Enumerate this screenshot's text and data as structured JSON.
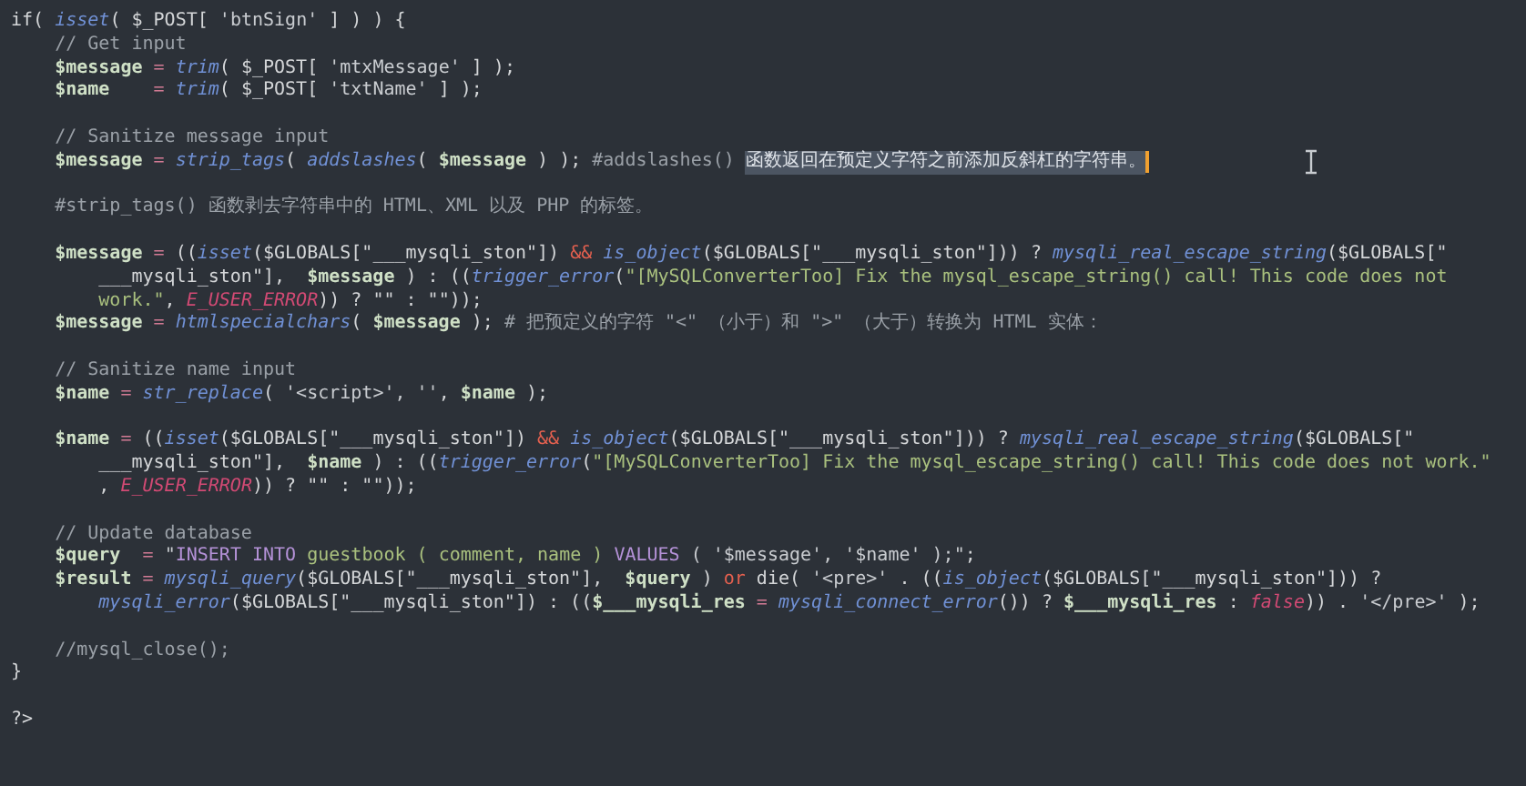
{
  "editor": {
    "lines": [
      {
        "kind": "code",
        "tokens": [
          {
            "kind": "plain",
            "t": "if( "
          },
          {
            "kind": "fn",
            "t": "isset"
          },
          {
            "kind": "plain",
            "t": "( $_POST[ "
          },
          {
            "kind": "str",
            "t": "'btnSign'"
          },
          {
            "kind": "plain",
            "t": " ] ) ) {"
          }
        ]
      },
      {
        "kind": "code",
        "tokens": [
          {
            "kind": "cmt",
            "t": "    // Get input"
          }
        ]
      },
      {
        "kind": "code",
        "tokens": [
          {
            "kind": "var",
            "t": "    $message"
          },
          {
            "kind": "op",
            "t": " = "
          },
          {
            "kind": "fn",
            "t": "trim"
          },
          {
            "kind": "plain",
            "t": "( $_POST[ "
          },
          {
            "kind": "str",
            "t": "'mtxMessage'"
          },
          {
            "kind": "plain",
            "t": " ] );"
          }
        ]
      },
      {
        "kind": "code",
        "tokens": [
          {
            "kind": "var",
            "t": "    $name"
          },
          {
            "kind": "op",
            "t": "    = "
          },
          {
            "kind": "fn",
            "t": "trim"
          },
          {
            "kind": "plain",
            "t": "( $_POST[ "
          },
          {
            "kind": "str",
            "t": "'txtName'"
          },
          {
            "kind": "plain",
            "t": " ] );"
          }
        ]
      },
      {
        "kind": "blank"
      },
      {
        "kind": "code",
        "tokens": [
          {
            "kind": "cmt",
            "t": "    // Sanitize message input"
          }
        ]
      },
      {
        "kind": "code",
        "tokens": [
          {
            "kind": "var",
            "t": "    $message"
          },
          {
            "kind": "op",
            "t": " = "
          },
          {
            "kind": "fn",
            "t": "strip_tags"
          },
          {
            "kind": "plain",
            "t": "( "
          },
          {
            "kind": "fn",
            "t": "addslashes"
          },
          {
            "kind": "plain",
            "t": "( "
          },
          {
            "kind": "var",
            "t": "$message"
          },
          {
            "kind": "plain",
            "t": " ) ); "
          },
          {
            "kind": "cmt",
            "t": "#addslashes() "
          },
          {
            "kind": "sel",
            "t": "函数返回在预定义字符之前添加反斜杠的字符串。"
          }
        ],
        "caret": true
      },
      {
        "kind": "blank"
      },
      {
        "kind": "code",
        "tokens": [
          {
            "kind": "cmt",
            "t": "    #strip_tags() 函数剥去字符串中的 HTML、XML 以及 PHP 的标签。"
          }
        ]
      },
      {
        "kind": "blank"
      },
      {
        "kind": "code",
        "tokens": [
          {
            "kind": "var",
            "t": "    $message"
          },
          {
            "kind": "op",
            "t": " = "
          },
          {
            "kind": "plain",
            "t": "(("
          },
          {
            "kind": "fn",
            "t": "isset"
          },
          {
            "kind": "plain",
            "t": "($GLOBALS[\"___mysqli_ston\"]) "
          },
          {
            "kind": "kw",
            "t": "&&"
          },
          {
            "kind": "fn",
            "t": " is_object"
          },
          {
            "kind": "plain",
            "t": "($GLOBALS[\"___mysqli_ston\"])) ? "
          },
          {
            "kind": "fn",
            "t": "mysqli_real_escape_string"
          },
          {
            "kind": "plain",
            "t": "($GLOBALS[\""
          }
        ]
      },
      {
        "kind": "code",
        "tokens": [
          {
            "kind": "plain",
            "t": "        ___mysqli_ston\"],  "
          },
          {
            "kind": "var",
            "t": "$message"
          },
          {
            "kind": "plain",
            "t": " ) : (("
          },
          {
            "kind": "fn",
            "t": "trigger_error"
          },
          {
            "kind": "plain",
            "t": "("
          },
          {
            "kind": "green",
            "t": "\"[MySQLConverterToo] Fix the mysql_escape_string() call! This code does not"
          }
        ]
      },
      {
        "kind": "code",
        "tokens": [
          {
            "kind": "green",
            "t": "        work.\""
          },
          {
            "kind": "plain",
            "t": ", "
          },
          {
            "kind": "const",
            "t": "E_USER_ERROR"
          },
          {
            "kind": "plain",
            "t": ")) ? \"\" : \"\"));"
          }
        ]
      },
      {
        "kind": "code",
        "tokens": [
          {
            "kind": "var",
            "t": "    $message"
          },
          {
            "kind": "op",
            "t": " = "
          },
          {
            "kind": "fn",
            "t": "htmlspecialchars"
          },
          {
            "kind": "plain",
            "t": "( "
          },
          {
            "kind": "var",
            "t": "$message"
          },
          {
            "kind": "plain",
            "t": " ); "
          },
          {
            "kind": "cmt",
            "t": "# 把预定义的字符 \"<\" （小于）和 \">\" （大于）转换为 HTML 实体："
          }
        ]
      },
      {
        "kind": "blank"
      },
      {
        "kind": "code",
        "tokens": [
          {
            "kind": "cmt",
            "t": "    // Sanitize name input"
          }
        ]
      },
      {
        "kind": "code",
        "tokens": [
          {
            "kind": "var",
            "t": "    $name"
          },
          {
            "kind": "op",
            "t": " = "
          },
          {
            "kind": "fn",
            "t": "str_replace"
          },
          {
            "kind": "plain",
            "t": "( "
          },
          {
            "kind": "str",
            "t": "'<script>', ''"
          },
          {
            "kind": "plain",
            "t": ", "
          },
          {
            "kind": "var",
            "t": "$name"
          },
          {
            "kind": "plain",
            "t": " );"
          }
        ]
      },
      {
        "kind": "blank"
      },
      {
        "kind": "code",
        "tokens": [
          {
            "kind": "var",
            "t": "    $name"
          },
          {
            "kind": "op",
            "t": " = "
          },
          {
            "kind": "plain",
            "t": "(("
          },
          {
            "kind": "fn",
            "t": "isset"
          },
          {
            "kind": "plain",
            "t": "($GLOBALS[\"___mysqli_ston\"]) "
          },
          {
            "kind": "kw",
            "t": "&&"
          },
          {
            "kind": "fn",
            "t": " is_object"
          },
          {
            "kind": "plain",
            "t": "($GLOBALS[\"___mysqli_ston\"])) ? "
          },
          {
            "kind": "fn",
            "t": "mysqli_real_escape_string"
          },
          {
            "kind": "plain",
            "t": "($GLOBALS[\""
          }
        ]
      },
      {
        "kind": "code",
        "tokens": [
          {
            "kind": "plain",
            "t": "        ___mysqli_ston\"],  "
          },
          {
            "kind": "var",
            "t": "$name"
          },
          {
            "kind": "plain",
            "t": " ) : (("
          },
          {
            "kind": "fn",
            "t": "trigger_error"
          },
          {
            "kind": "plain",
            "t": "("
          },
          {
            "kind": "green",
            "t": "\"[MySQLConverterToo] Fix the mysql_escape_string() call! This code does not work.\""
          }
        ]
      },
      {
        "kind": "code",
        "tokens": [
          {
            "kind": "plain",
            "t": "        , "
          },
          {
            "kind": "const",
            "t": "E_USER_ERROR"
          },
          {
            "kind": "plain",
            "t": ")) ? \"\" : \"\"));"
          }
        ]
      },
      {
        "kind": "blank"
      },
      {
        "kind": "code",
        "tokens": [
          {
            "kind": "cmt",
            "t": "    // Update database"
          }
        ]
      },
      {
        "kind": "code",
        "tokens": [
          {
            "kind": "var",
            "t": "    $query"
          },
          {
            "kind": "op",
            "t": "  = "
          },
          {
            "kind": "str",
            "t": "\""
          },
          {
            "kind": "sql",
            "t": "INSERT INTO"
          },
          {
            "kind": "green",
            "t": " guestbook ( comment, name ) "
          },
          {
            "kind": "sql",
            "t": "VALUES"
          },
          {
            "kind": "str",
            "t": " ( '$message', '$name' );\""
          },
          {
            "kind": "plain",
            "t": ";"
          }
        ]
      },
      {
        "kind": "code",
        "tokens": [
          {
            "kind": "var",
            "t": "    $result"
          },
          {
            "kind": "op",
            "t": " = "
          },
          {
            "kind": "fn",
            "t": "mysqli_query"
          },
          {
            "kind": "plain",
            "t": "($GLOBALS[\"___mysqli_ston\"],  "
          },
          {
            "kind": "var",
            "t": "$query"
          },
          {
            "kind": "plain",
            "t": " ) "
          },
          {
            "kind": "kw",
            "t": "or"
          },
          {
            "kind": "plain",
            "t": " die( "
          },
          {
            "kind": "str",
            "t": "'<pre>'"
          },
          {
            "kind": "plain",
            "t": " . (("
          },
          {
            "kind": "fn",
            "t": "is_object"
          },
          {
            "kind": "plain",
            "t": "($GLOBALS[\"___mysqli_ston\"])) ?"
          }
        ]
      },
      {
        "kind": "code",
        "tokens": [
          {
            "kind": "fn",
            "t": "        mysqli_error"
          },
          {
            "kind": "plain",
            "t": "($GLOBALS[\"___mysqli_ston\"]) : (("
          },
          {
            "kind": "var",
            "t": "$___mysqli_res"
          },
          {
            "kind": "op",
            "t": " = "
          },
          {
            "kind": "fn",
            "t": "mysqli_connect_error"
          },
          {
            "kind": "plain",
            "t": "()) ? "
          },
          {
            "kind": "var",
            "t": "$___mysqli_res"
          },
          {
            "kind": "plain",
            "t": " : "
          },
          {
            "kind": "const",
            "t": "false"
          },
          {
            "kind": "plain",
            "t": ")) . "
          },
          {
            "kind": "str",
            "t": "'</pre>'"
          },
          {
            "kind": "plain",
            "t": " );"
          }
        ]
      },
      {
        "kind": "blank"
      },
      {
        "kind": "code",
        "tokens": [
          {
            "kind": "cmt",
            "t": "    //mysql_close();"
          }
        ]
      },
      {
        "kind": "code",
        "tokens": [
          {
            "kind": "plain",
            "t": "}"
          }
        ]
      },
      {
        "kind": "blank"
      },
      {
        "kind": "code",
        "tokens": [
          {
            "kind": "plain",
            "t": "?>"
          }
        ]
      }
    ]
  }
}
